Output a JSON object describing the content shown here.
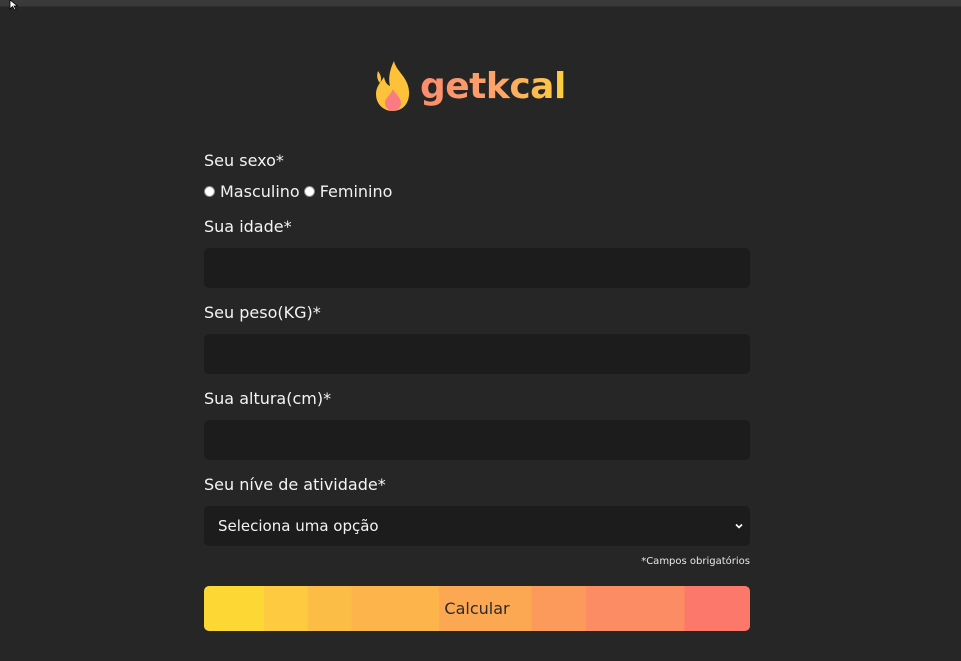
{
  "logo": {
    "text": "getkcal",
    "icon": "flame-icon"
  },
  "form": {
    "sex": {
      "label": "Seu sexo*",
      "options": [
        "Masculino",
        "Feminino"
      ]
    },
    "age": {
      "label": "Sua idade*",
      "value": ""
    },
    "weight": {
      "label": "Seu peso(KG)*",
      "value": ""
    },
    "height": {
      "label": "Sua altura(cm)*",
      "value": ""
    },
    "activity": {
      "label": "Seu níve de atividade*",
      "selected": "Seleciona uma opção"
    },
    "required_note": "*Campos obrigatórios",
    "submit_label": "Calcular"
  },
  "colors": {
    "background": "#262626",
    "input_bg": "#1c1c1c",
    "gradient_start": "#fdd835",
    "gradient_end": "#fc786b",
    "flame_yellow": "#fdc13a",
    "flame_pink": "#fb7b83"
  }
}
